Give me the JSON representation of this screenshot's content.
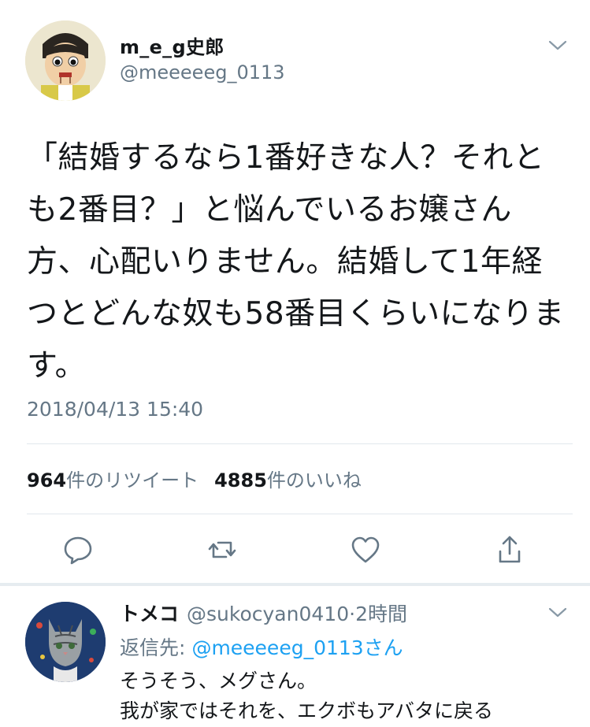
{
  "tweet": {
    "author_name": "m_e_g史郎",
    "author_handle": "@meeeeeg_0113",
    "text": "「結婚するなら1番好きな人？それとも2番目？」と悩んでいるお嬢さん方、心配いりません。結婚して1年経つとどんな奴も58番目くらいになります。",
    "timestamp": "2018/04/13 15:40",
    "retweet_count": "964",
    "retweet_label": "件のリツイート",
    "like_count": "4885",
    "like_label": "件のいいね"
  },
  "actions": {
    "icons": [
      "reply-icon",
      "retweet-icon",
      "like-icon",
      "share-icon"
    ]
  },
  "reply": {
    "name": "トメコ",
    "handle": "@sukocyan0410",
    "separator": "·",
    "time": "2時間",
    "reply_to_label": "返信先:",
    "reply_to_handle": "@meeeeeg_0113さん",
    "lines": [
      "そうそう、メグさん。",
      "我が家ではそれを、エクボもアバタに戻る"
    ]
  },
  "colors": {
    "text": "#14171a",
    "secondary": "#657786",
    "link": "#1da1f2",
    "divider": "#e1e8ed"
  }
}
